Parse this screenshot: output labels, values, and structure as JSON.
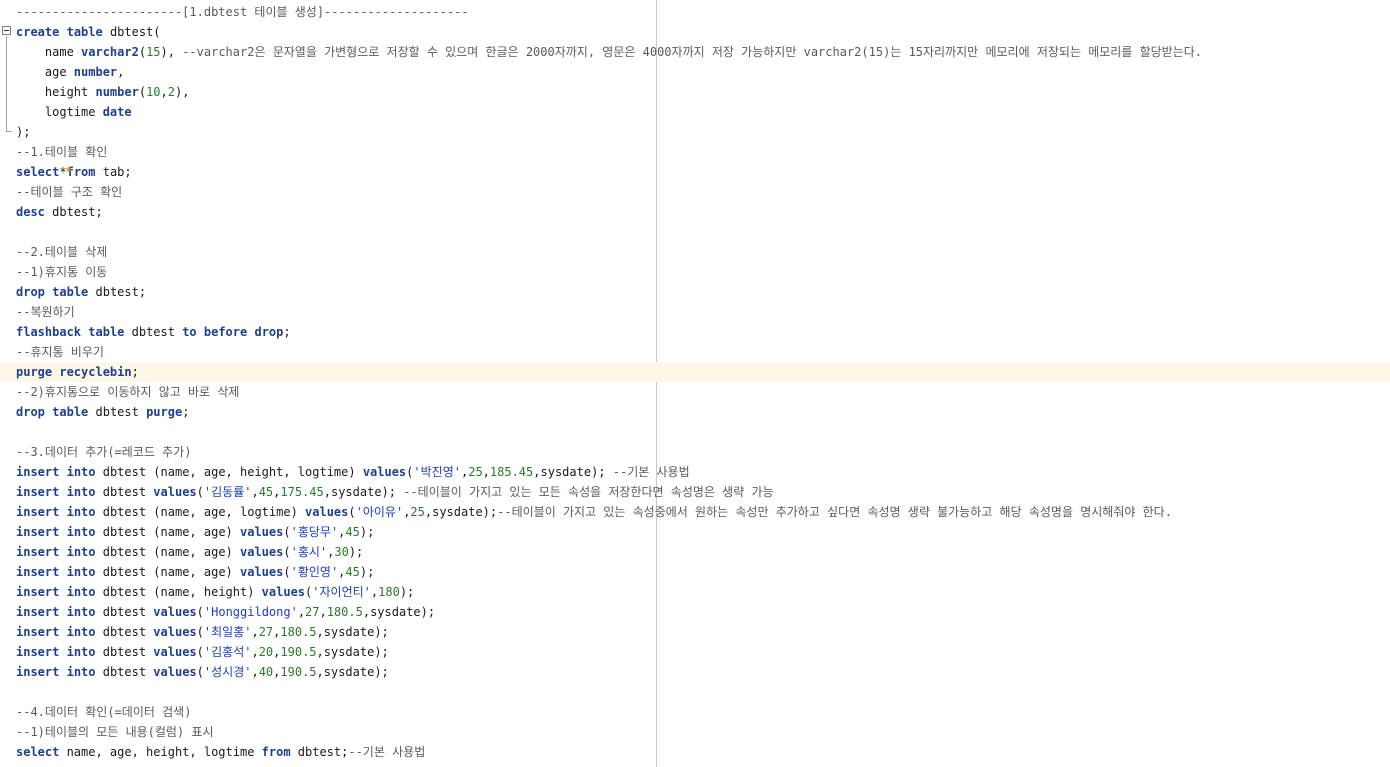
{
  "editor": {
    "lines": [
      "-----------------------[1.dbtest 테이블 생성]--------------------",
      "create table dbtest(",
      "    name varchar2(15), --varchar2은 문자열을 가변형으로 저장할 수 있으며 한글은 2000자까지, 영문은 4000자까지 저장 가능하지만 varchar2(15)는 15자리까지만 메모리에 저장되는 메모리를 할당받는다.",
      "    age number,",
      "    height number(10,2),",
      "    logtime date",
      ");",
      "--1.테이블 확인",
      "select*from tab;",
      "--테이블 구조 확인",
      "desc dbtest;",
      "",
      "--2.테이블 삭제",
      "--1)휴지통 이동",
      "drop table dbtest;",
      "--복원하기",
      "flashback table dbtest to before drop;",
      "--휴지통 비우기",
      "purge recyclebin;",
      "--2)휴지통으로 이동하지 않고 바로 삭제",
      "drop table dbtest purge;",
      "",
      "--3.데이터 추가(=레코드 추가)",
      "insert into dbtest (name, age, height, logtime) values('박진영',25,185.45,sysdate); --기본 사용법",
      "insert into dbtest values('김동률',45,175.45,sysdate); --테이블이 가지고 있는 모든 속성을 저장한다면 속성명은 생략 가능",
      "insert into dbtest (name, age, logtime) values('아이유',25,sysdate);--테이블이 가지고 있는 속성중에서 원하는 속성만 추가하고 싶다면 속성명 생략 불가능하고 해당 속성명을 명시해줘야 한다.",
      "insert into dbtest (name, age) values('홍당무',45);",
      "insert into dbtest (name, age) values('홍시',30);",
      "insert into dbtest (name, age) values('황인영',45);",
      "insert into dbtest (name, height) values('자이언티',180);",
      "insert into dbtest values('Honggildong',27,180.5,sysdate);",
      "insert into dbtest values('최일홍',27,180.5,sysdate);",
      "insert into dbtest values('김홍석',20,190.5,sysdate);",
      "insert into dbtest values('성시경',40,190.5,sysdate);",
      "",
      "--4.데이터 확인(=데이터 검색)",
      "--1)테이블의 모든 내용(컬럼) 표시",
      "select name, age, height, logtime from dbtest;--기본 사용법"
    ],
    "current_line_index": 18,
    "colors": {
      "keyword": "#1e3f8f",
      "comment": "#5a5a5a",
      "string": "#1a3cc8",
      "number": "#2a7a2a",
      "current_line": "#fdf8e6"
    }
  }
}
